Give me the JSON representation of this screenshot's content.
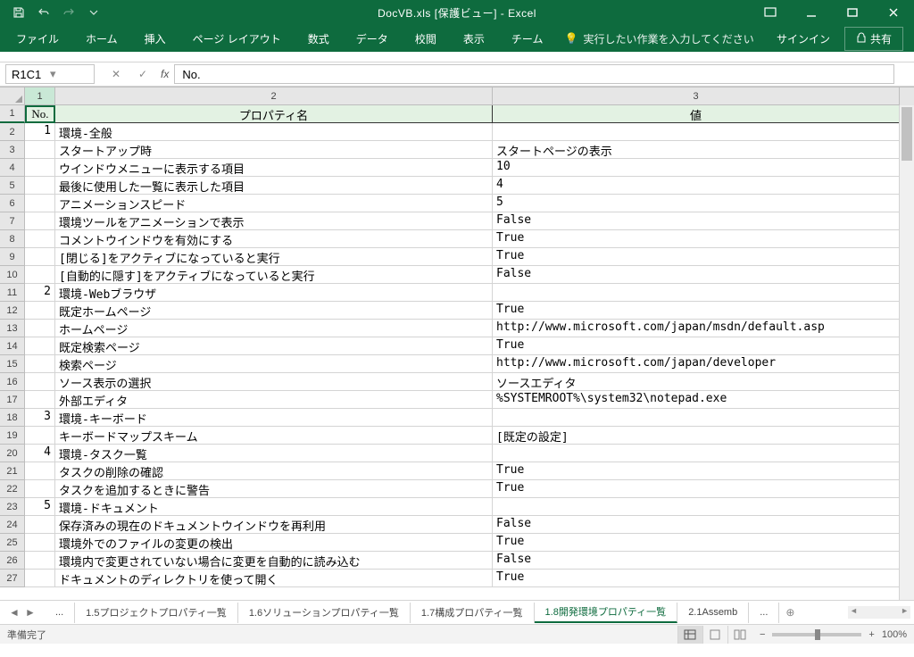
{
  "title": "DocVB.xls  [保護ビュー] - Excel",
  "qat": {
    "save": "save",
    "undo": "undo",
    "redo": "redo",
    "custom": "customize"
  },
  "tabs": [
    "ファイル",
    "ホーム",
    "挿入",
    "ページ レイアウト",
    "数式",
    "データ",
    "校閲",
    "表示",
    "チーム"
  ],
  "tell_me": "実行したい作業を入力してください",
  "signin": "サインイン",
  "share": "共有",
  "name_box": "R1C1",
  "formula": "No.",
  "col_headers": [
    "1",
    "2",
    "3"
  ],
  "header_row": [
    "No.",
    "プロパティ名",
    "値"
  ],
  "rows": [
    {
      "rn": 2,
      "no": "1",
      "p": "環境-全般",
      "v": ""
    },
    {
      "rn": 3,
      "no": "",
      "p": "スタートアップ時",
      "v": "スタートページの表示"
    },
    {
      "rn": 4,
      "no": "",
      "p": "ウインドウメニューに表示する項目",
      "v": "10"
    },
    {
      "rn": 5,
      "no": "",
      "p": "最後に使用した一覧に表示した項目",
      "v": "4"
    },
    {
      "rn": 6,
      "no": "",
      "p": "アニメーションスピード",
      "v": "5"
    },
    {
      "rn": 7,
      "no": "",
      "p": "環境ツールをアニメーションで表示",
      "v": "False"
    },
    {
      "rn": 8,
      "no": "",
      "p": "コメントウインドウを有効にする",
      "v": "True"
    },
    {
      "rn": 9,
      "no": "",
      "p": "[閉じる]をアクティブになっていると実行",
      "v": "True"
    },
    {
      "rn": 10,
      "no": "",
      "p": "[自動的に隠す]をアクティブになっていると実行",
      "v": "False"
    },
    {
      "rn": 11,
      "no": "2",
      "p": "環境-Webブラウザ",
      "v": ""
    },
    {
      "rn": 12,
      "no": "",
      "p": "既定ホームページ",
      "v": "True"
    },
    {
      "rn": 13,
      "no": "",
      "p": "ホームページ",
      "v": "http://www.microsoft.com/japan/msdn/default.asp"
    },
    {
      "rn": 14,
      "no": "",
      "p": "既定検索ページ",
      "v": "True"
    },
    {
      "rn": 15,
      "no": "",
      "p": "検索ページ",
      "v": "http://www.microsoft.com/japan/developer"
    },
    {
      "rn": 16,
      "no": "",
      "p": "ソース表示の選択",
      "v": "ソースエディタ"
    },
    {
      "rn": 17,
      "no": "",
      "p": "外部エディタ",
      "v": "%SYSTEMROOT%\\system32\\notepad.exe"
    },
    {
      "rn": 18,
      "no": "3",
      "p": "環境-キーボード",
      "v": ""
    },
    {
      "rn": 19,
      "no": "",
      "p": "キーボードマップスキーム",
      "v": "[既定の設定]"
    },
    {
      "rn": 20,
      "no": "4",
      "p": "環境-タスク一覧",
      "v": ""
    },
    {
      "rn": 21,
      "no": "",
      "p": "タスクの削除の確認",
      "v": "True"
    },
    {
      "rn": 22,
      "no": "",
      "p": "タスクを追加するときに警告",
      "v": "True"
    },
    {
      "rn": 23,
      "no": "5",
      "p": "環境-ドキュメント",
      "v": ""
    },
    {
      "rn": 24,
      "no": "",
      "p": "保存済みの現在のドキュメントウインドウを再利用",
      "v": "False"
    },
    {
      "rn": 25,
      "no": "",
      "p": "環境外でのファイルの変更の検出",
      "v": "True"
    },
    {
      "rn": 26,
      "no": "",
      "p": "環境内で変更されていない場合に変更を自動的に読み込む",
      "v": "False"
    },
    {
      "rn": 27,
      "no": "",
      "p": "ドキュメントのディレクトリを使って開く",
      "v": "True"
    }
  ],
  "sheet_tabs": [
    "...",
    "1.5プロジェクトプロパティ一覧",
    "1.6ソリューションプロパティ一覧",
    "1.7構成プロパティ一覧",
    "1.8開発環境プロパティ一覧",
    "2.1Assemb",
    "..."
  ],
  "active_sheet": "1.8開発環境プロパティ一覧",
  "status": "準備完了",
  "zoom": "100%"
}
